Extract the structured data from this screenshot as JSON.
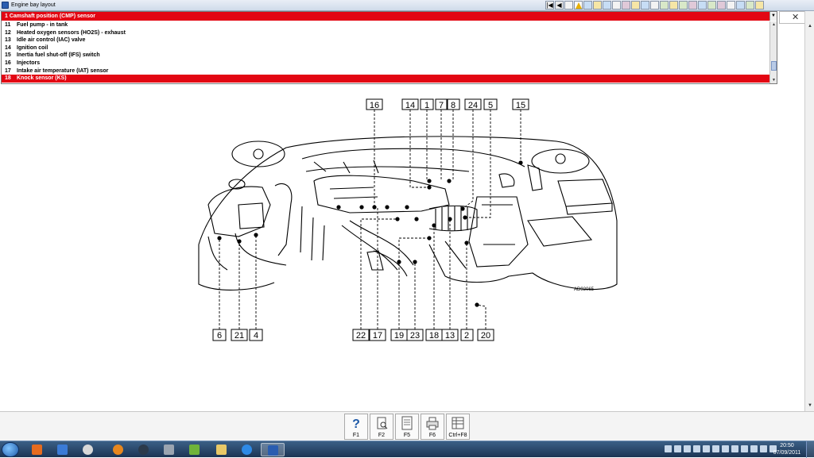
{
  "window": {
    "title": "Engine bay layout"
  },
  "toolbar": {
    "first": "|◀",
    "prev": "◀"
  },
  "dropdown": {
    "value": "1    Camshaft position (CMP) sensor"
  },
  "list": {
    "items": [
      {
        "num": "11",
        "label": "Fuel pump - in tank",
        "selected": false
      },
      {
        "num": "12",
        "label": "Heated oxygen sensors (HO2S) - exhaust",
        "selected": false
      },
      {
        "num": "13",
        "label": "Idle air control (IAC) valve",
        "selected": false
      },
      {
        "num": "14",
        "label": "Ignition coil",
        "selected": false
      },
      {
        "num": "15",
        "label": "Inertia fuel shut-off (IFS) switch",
        "selected": false
      },
      {
        "num": "16",
        "label": "Injectors",
        "selected": false
      },
      {
        "num": "17",
        "label": "Intake air temperature (IAT) sensor",
        "selected": false
      },
      {
        "num": "18",
        "label": "Knock sensor (KS)",
        "selected": true
      }
    ]
  },
  "diagram": {
    "code": "AD92065",
    "top_labels": [
      "16",
      "14",
      "1",
      "7",
      "8",
      "24",
      "5",
      "15"
    ],
    "bottom_labels": [
      "6",
      "21",
      "4",
      "22",
      "17",
      "19",
      "23",
      "18",
      "13",
      "2",
      "20"
    ]
  },
  "fkeys": [
    {
      "label": "F1",
      "icon": "help-icon"
    },
    {
      "label": "F2",
      "icon": "print-preview-icon"
    },
    {
      "label": "F5",
      "icon": "document-icon"
    },
    {
      "label": "F6",
      "icon": "printer-icon"
    },
    {
      "label": "Ctrl+F8",
      "icon": "table-icon"
    }
  ],
  "taskbar": {
    "clock_time": "20:50",
    "clock_date": "07/09/2011"
  },
  "colors": {
    "accent_red": "#e30613",
    "taskbar": "#1c3554"
  }
}
